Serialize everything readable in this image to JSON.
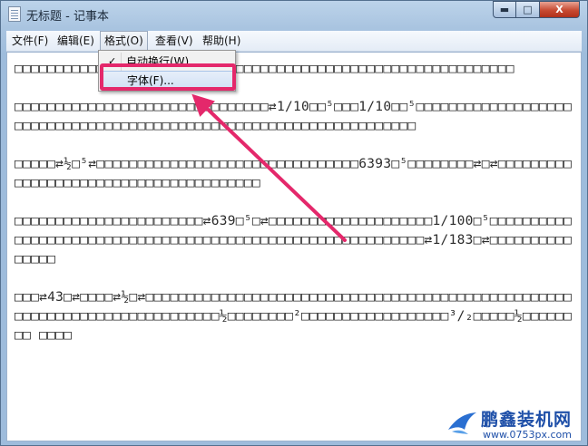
{
  "window": {
    "title": "无标题 - 记事本",
    "buttons": {
      "minimize": "▬",
      "maximize": "□",
      "close": "X"
    }
  },
  "menubar": [
    {
      "label": "文件(F)"
    },
    {
      "label": "编辑(E)"
    },
    {
      "label": "格式(O)"
    },
    {
      "label": "查看(V)"
    },
    {
      "label": "帮助(H)"
    }
  ],
  "format_menu": {
    "items": [
      {
        "label": "自动换行(W)",
        "checked": "✓"
      },
      {
        "label": "字体(F)..."
      }
    ]
  },
  "editor": {
    "paragraphs": [
      "□□□□□□□□□□□□□□□□□□□□□□□□□□□□□□□□□□□□□□□□□□□□□□□□□□□□□□□□□□□□□",
      "□□□□□□□□□□□□□□□□□□□□□□□□□□□□□□□⇄1/10□□⁵□□□1/10□□⁵□□□□□□□□□□□□□□□□□□□□□□□□□□□□□□□□□□□□□□□□□□□□□□□□□□□□□□□□□□□□□□□□□□□□",
      "□□□□□⇄½□⁵⇄□□□□□□□□□□□□□□□□□□□□□□□□□□□□□□□□6393□⁵□□□□□□□□⇄□⇄□□□□□□□□□□□□□□□□□□□□□□□□□□□□□□□□□□□□□□□",
      "□□□□□□□□□□□□□□□□□□□□□□□⇄639□⁵□⇄□□□□□□□□□□□□□□□□□□□□1/100□⁵□□□□□□□□□□□□□□□□□□□□□□□□□□□□□□□□□□□□□□□□□□□□□□□□□□□□□□□□□□□□⇄1/183□⇄□□□□□□□□□□□□□□□",
      "□□□⇄43□⇄□□□□⇄½□⇄□□□□□□□□□□□□□□□□□□□□□□□□□□□□□□□□□□□□□□□□□□□□□□□□□□□□□□□□□□□□□□□□□□□□□□□□□□□□□½□□□□□□□□²□□□□□□□□□□□□□□□□□□³/₂□□□□□½□□□□□□□□ □□□□"
    ]
  },
  "watermark": {
    "name": "鹏鑫装机网",
    "url": "www.0753px.com"
  },
  "colors": {
    "highlight": "#e4286b",
    "arrow": "#e4286b",
    "watermark": "#1e4fa8"
  }
}
